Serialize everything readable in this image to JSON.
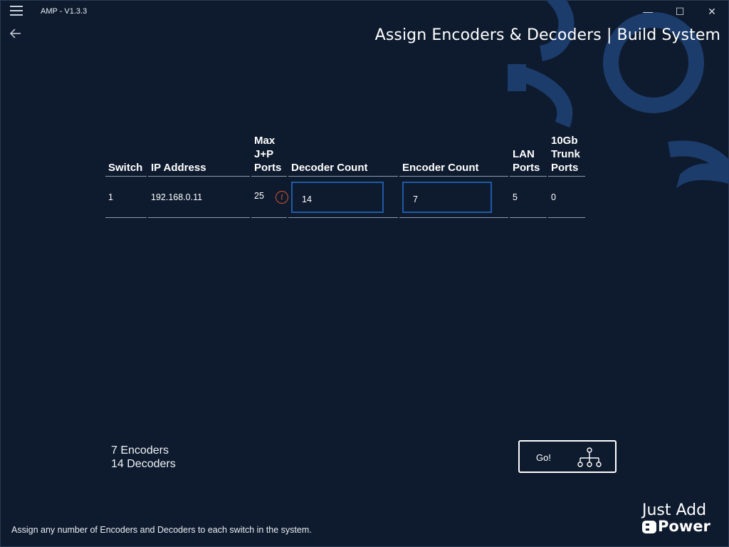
{
  "window": {
    "app_title": "AMP - V1.3.3",
    "minimize_glyph": "—",
    "maximize_glyph": "☐",
    "close_glyph": "✕"
  },
  "page": {
    "title": "Assign Encoders & Decoders | Build System"
  },
  "table": {
    "headers": {
      "switch": "Switch",
      "ip": "IP Address",
      "max_ports": "Max J+P Ports",
      "decoder_count": "Decoder Count",
      "encoder_count": "Encoder Count",
      "lan_ports": "LAN Ports",
      "trunk_ports": "10Gb Trunk Ports"
    },
    "rows": [
      {
        "switch": "1",
        "ip": "192.168.0.11",
        "max_ports": "25",
        "decoder_count": "14",
        "encoder_count": "7",
        "lan_ports": "5",
        "trunk_ports": "0"
      }
    ]
  },
  "summary": {
    "encoders": "7 Encoders",
    "decoders": "14 Decoders"
  },
  "go_button": {
    "label": "Go!",
    "icon": "network-tree-icon"
  },
  "footer": {
    "hint": "Assign any number of Encoders and Decoders to each switch in the system."
  },
  "logo": {
    "line1": "Just Add",
    "line2": "Power"
  },
  "colors": {
    "background": "#0e1b2e",
    "decor": "#1c3c6b",
    "input_border": "#1f5aa6",
    "info_icon": "#d6532c"
  }
}
